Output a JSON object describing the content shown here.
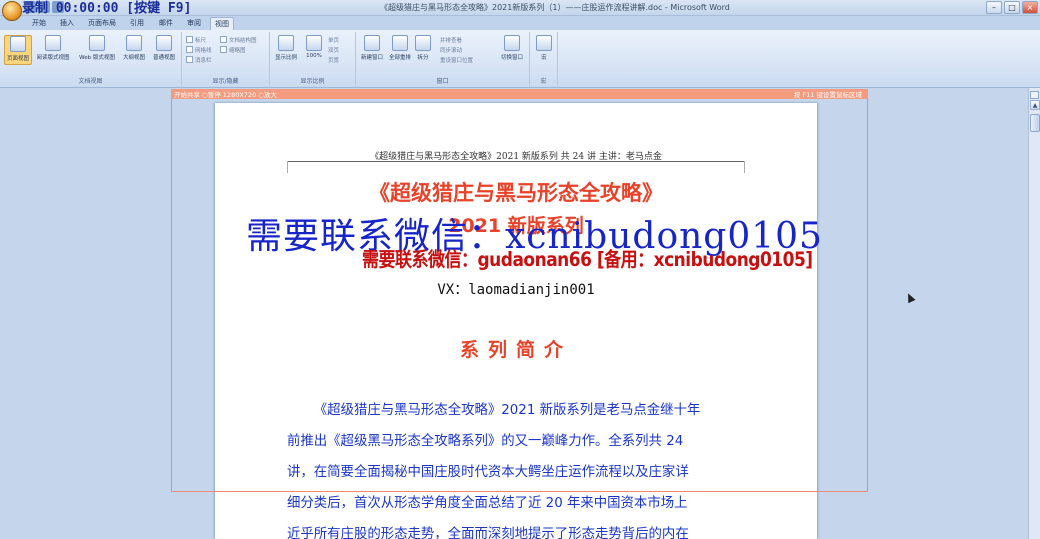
{
  "window": {
    "title": "《超级猎庄与黑马形态全攻略》2021新版系列（1）——庄股运作流程讲解.doc - Microsoft Word",
    "recording_overlay": "录制 00:00:00 [按键 F9]"
  },
  "ribbon": {
    "tabs": [
      "开始",
      "插入",
      "页面布局",
      "引用",
      "邮件",
      "审阅",
      "视图"
    ],
    "active_tab": "视图",
    "doc_views": {
      "buttons": [
        "页面视图",
        "阅读版式视图",
        "Web 版式视图",
        "大纲视图",
        "普通视图"
      ],
      "label": "文档视图"
    },
    "show_hide": {
      "checks": [
        "标尺",
        "网格线",
        "消息栏",
        "文档结构图",
        "缩略图"
      ],
      "label": "显示/隐藏"
    },
    "zoom": {
      "buttons": [
        "显示比例",
        "100%"
      ],
      "small": [
        "单页",
        "双页",
        "页宽"
      ],
      "label": "显示比例"
    },
    "window": {
      "buttons": [
        "新建窗口",
        "全部重排",
        "拆分"
      ],
      "small": [
        "并排查看",
        "同步滚动",
        "重设窗口位置"
      ],
      "switch": "切换窗口",
      "label": "窗口"
    },
    "macro": {
      "button": "宏",
      "label": "宏"
    }
  },
  "recorder": {
    "left_label": "开始共享  ○暂停  1280X720  ○放大",
    "right_label": "按 F11 键设置鼠标区域"
  },
  "document": {
    "running_header": "《超级猎庄与黑马形态全攻略》2021 新版系列  共 24 讲   主讲：老马点金",
    "title": "《超级猎庄与黑马形态全攻略》",
    "subtitle": "2021 新版系列",
    "vx_line": "VX：laomadianjin001",
    "section_title": "系列简介",
    "intro_lines": [
      "《超级猎庄与黑马形态全攻略》2021 新版系列是老马点金继十年",
      "前推出《超级黑马形态全攻略系列》的又一巅峰力作。全系列共 24",
      "讲，在简要全面揭秘中国庄股时代资本大鳄坐庄运作流程以及庄家详",
      "细分类后，首次从形态学角度全面总结了近 20 年来中国资本市场上",
      "近乎所有庄股的形态走势，全面而深刻地提示了形态走势背后的内在"
    ]
  },
  "watermarks": {
    "big": "需要联系微信：xcnibudong0105",
    "stamp": "需要联系微信：gudaonan66 [备用：xcnibudong0105]"
  },
  "colors": {
    "title_red": "#e8432a",
    "body_blue": "#1b35c8",
    "watermark_blue": "#1725c8",
    "stamp_red": "#c81010"
  }
}
